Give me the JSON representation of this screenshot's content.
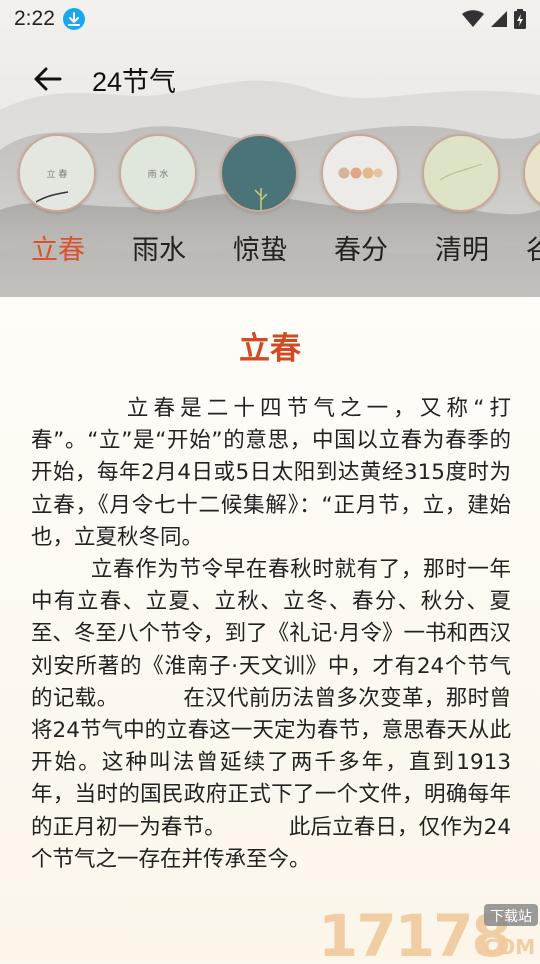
{
  "status_bar": {
    "time": "2:22",
    "icons": [
      "download-icon",
      "wifi-icon",
      "signal-icon",
      "battery-icon"
    ]
  },
  "toolbar": {
    "back_icon": "arrow-left-icon",
    "title": "24节气"
  },
  "terms": [
    {
      "label": "立春",
      "active": true,
      "circle_text": "立 春",
      "circle_bg": "#e4e7df"
    },
    {
      "label": "雨水",
      "active": false,
      "circle_text": "雨 水",
      "circle_bg": "#dfe6dc"
    },
    {
      "label": "惊蛰",
      "active": false,
      "circle_text": "",
      "circle_bg": "#4a7478"
    },
    {
      "label": "春分",
      "active": false,
      "circle_text": "",
      "circle_bg": "#ecebe7"
    },
    {
      "label": "清明",
      "active": false,
      "circle_text": "",
      "circle_bg": "#dde3c5"
    },
    {
      "label": "谷",
      "active": false,
      "circle_text": "",
      "circle_bg": "#e9e4c9"
    }
  ],
  "article": {
    "title": "立春",
    "body": "        立春是二十四节气之一，又称“打春”。“立”是“开始”的意思，中国以立春为春季的开始，每年2月4日或5日太阳到达黄经315度时为立春，《月令七十二候集解》：“正月节，立，建始也，立夏秋冬同。\n        立春作为节令早在春秋时就有了，那时一年中有立春、立夏、立秋、立冬、春分、秋分、夏至、冬至八个节令，到了《礼记·月令》一书和西汉刘安所著的《淮南子·天文训》中，才有24个节气的记载。         在汉代前历法曾多次变革，那时曾将24节气中的立春这一天定为春节，意思春天从此开始。这种叫法曾延续了两千多年，直到1913年，当时的国民政府正式下了一个文件，明确每年的正月初一为春节。         此后立春日，仅作为24个节气之一存在并传承至今。"
  },
  "watermark": {
    "digits": "17178",
    "domain": ".COM",
    "tag": "下载站"
  },
  "colors": {
    "accent": "#d9532f",
    "title": "#d24a24",
    "circle_border": "#c9a89a"
  }
}
